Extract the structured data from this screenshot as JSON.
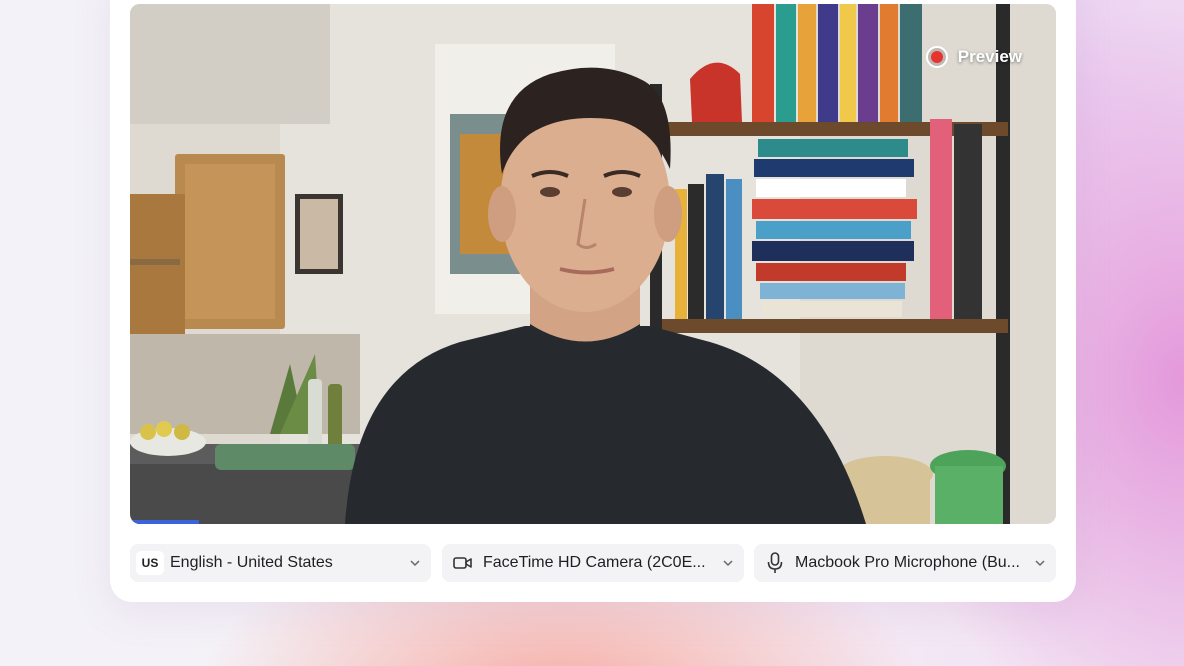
{
  "preview": {
    "label": "Preview",
    "record_icon": "record-icon",
    "record_color": "#e8342f"
  },
  "video": {
    "progress_fraction": 0.075,
    "progress_color": "#3d63d8"
  },
  "controls": {
    "language": {
      "badge": "US",
      "label": "English - United States",
      "icon": "chevron-down-icon"
    },
    "camera": {
      "label": "FaceTime HD Camera (2C0E...",
      "icon": "video-camera-icon"
    },
    "microphone": {
      "label": "Macbook Pro Microphone (Bu...",
      "icon": "microphone-icon"
    }
  }
}
